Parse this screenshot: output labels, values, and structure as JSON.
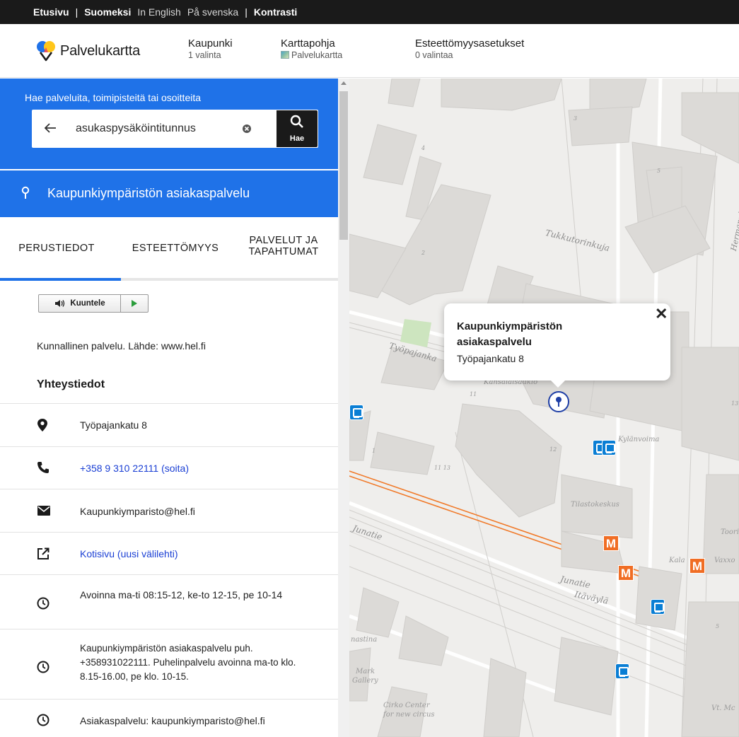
{
  "top_nav": {
    "home": "Etusivu",
    "sep": "|",
    "lang_fi": "Suomeksi",
    "lang_en": "In English",
    "lang_sv": "På svenska",
    "sep2": "|",
    "contrast": "Kontrasti"
  },
  "header": {
    "logo": "Palvelukartta",
    "city": {
      "title": "Kaupunki",
      "sub": "1 valinta"
    },
    "basemap": {
      "title": "Karttapohja",
      "sub": "Palvelukartta"
    },
    "accessibility": {
      "title": "Esteettömyysasetukset",
      "sub": "0 valintaa"
    }
  },
  "search": {
    "title": "Hae palveluita, toimipisteitä tai osoitteita",
    "value": "asukaspysäköintitunnus",
    "button_label": "Hae"
  },
  "unit": {
    "title": "Kaupunkiympäristön asiakaspalvelu"
  },
  "tabs": [
    {
      "label": "PERUSTIEDOT",
      "active": true
    },
    {
      "label": "ESTEETTÖMYYS",
      "active": false
    },
    {
      "label_line1": "PALVELUT JA",
      "label_line2": "TAPAHTUMAT",
      "active": false
    }
  ],
  "listen_button": "Kuuntele",
  "source_text": "Kunnallinen palvelu. Lähde: www.hel.fi",
  "contact_heading": "Yhteystiedot",
  "contacts": {
    "address": "Työpajankatu 8",
    "phone": "+358 9 310 22111 (soita)",
    "email": "Kaupunkiymparisto@hel.fi",
    "website": "Kotisivu (uusi välilehti)",
    "hours": "Avoinna ma-ti 08:15-12, ke-to 12-15, pe 10-14",
    "phone_service": "Kaupunkiympäristön asiakaspalvelu puh. +358931022111. Puhelinpalvelu avoinna ma-to klo. 8.15-16.00, pe klo. 10-15.",
    "customer_service": "Asiakaspalvelu: kaupunkiymparisto@hel.fi"
  },
  "map": {
    "popup": {
      "name": "Kaupunkiympäristön asiakaspalvelu",
      "address": "Työpajankatu 8",
      "close": "✕"
    },
    "labels": {
      "tukkutorinkuja": "Tukkutorinkuja",
      "tyopajankatu": "Työpajanka",
      "hermanninranta": "Hermannin ranta",
      "junatie1": "Junatie",
      "junatie2": "Junatie",
      "itavayla": "Itäväylä",
      "kansalaistori": "Kansalaisaukio",
      "tilastokeskus": "Tilastokeskus",
      "kylapolku": "Kylänvoima",
      "toori": "Toori",
      "kala": "Kala",
      "vaxxo": "Vaxxo",
      "mark_gallery1": "Mark",
      "mark_gallery2": "Gallery",
      "cirko1": "Cirko  Center",
      "cirko2": "for new circus",
      "hamstina": "nastina",
      "vitmc": "Vt. Mc",
      "n11": "11",
      "n1113": "11 13",
      "n2": "2",
      "n3": "3",
      "n4": "4",
      "n5": "5",
      "n5b": "5",
      "n13": "13",
      "n12": "12",
      "n1": "1"
    },
    "metro_letter": "M",
    "colors": {
      "metro": "#f06d24",
      "bus": "#0a7ed4",
      "rail": "#f07a2a",
      "building": "#dcdad7",
      "park": "#cde5bf"
    }
  }
}
